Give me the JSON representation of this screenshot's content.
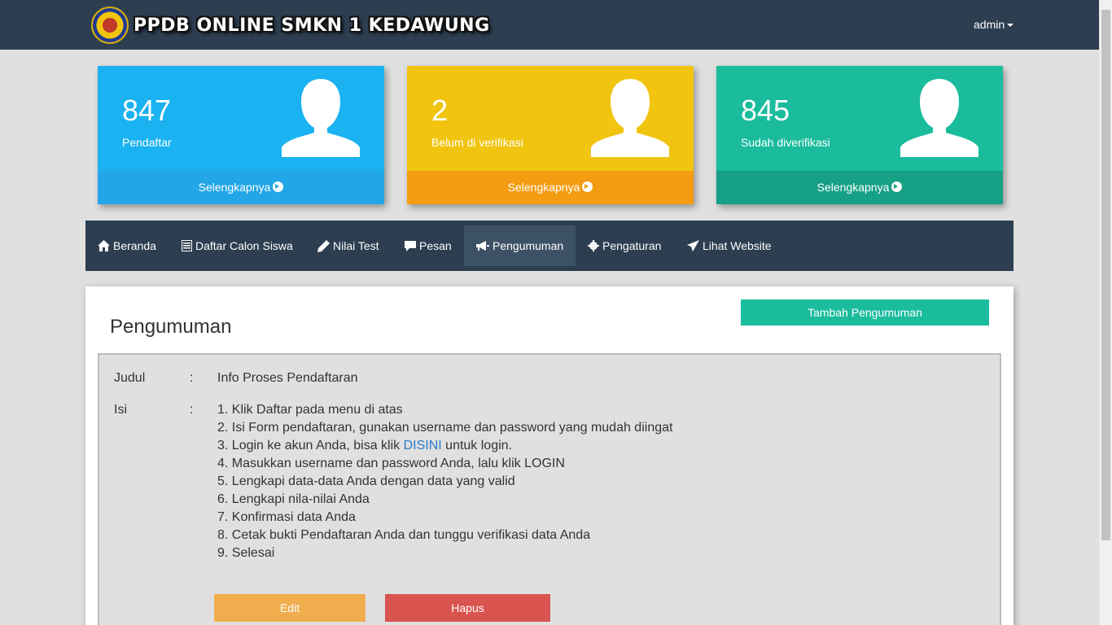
{
  "header": {
    "brand": "PPDB ONLINE SMKN 1 KEDAWUNG",
    "user_menu": "admin"
  },
  "stats": [
    {
      "value": "847",
      "label": "Pendaftar",
      "link": "Selengkapnya",
      "color": "#1ab2f0"
    },
    {
      "value": "2",
      "label": "Belum di verifikasi",
      "link": "Selengkapnya",
      "color": "#f1c40f"
    },
    {
      "value": "845",
      "label": "Sudah diverifikasi",
      "link": "Selengkapnya",
      "color": "#1abc9c"
    }
  ],
  "nav": {
    "items": [
      {
        "label": "Beranda",
        "icon": "home-icon"
      },
      {
        "label": "Daftar Calon Siswa",
        "icon": "list-icon"
      },
      {
        "label": "Nilai Test",
        "icon": "pencil-icon"
      },
      {
        "label": "Pesan",
        "icon": "comment-icon"
      },
      {
        "label": "Pengumuman",
        "icon": "bullhorn-icon",
        "active": true
      },
      {
        "label": "Pengaturan",
        "icon": "gear-icon"
      },
      {
        "label": "Lihat Website",
        "icon": "send-icon"
      }
    ]
  },
  "panel": {
    "title": "Pengumuman",
    "add_button": "Tambah Pengumuman",
    "judul_label": "Judul",
    "isi_label": "Isi",
    "colon": ":",
    "judul_value": "Info Proses Pendaftaran",
    "isi": {
      "line1": "1. Klik Daftar pada menu di atas",
      "line2": "2. Isi Form pendaftaran, gunakan username dan password yang mudah diingat",
      "line3_pre": "3. Login ke akun Anda, bisa klik ",
      "line3_link": "DISINI",
      "line3_post": " untuk login.",
      "line4": "4. Masukkan username dan password Anda, lalu klik LOGIN",
      "line5": "5. Lengkapi data-data Anda dengan data yang valid",
      "line6": "6. Lengkapi nila-nilai Anda",
      "line7": "7. Konfirmasi data Anda",
      "line8": "8. Cetak bukti Pendaftaran Anda dan tunggu verifikasi data Anda",
      "line9": "9. Selesai"
    },
    "edit_button": "Edit",
    "delete_button": "Hapus"
  }
}
